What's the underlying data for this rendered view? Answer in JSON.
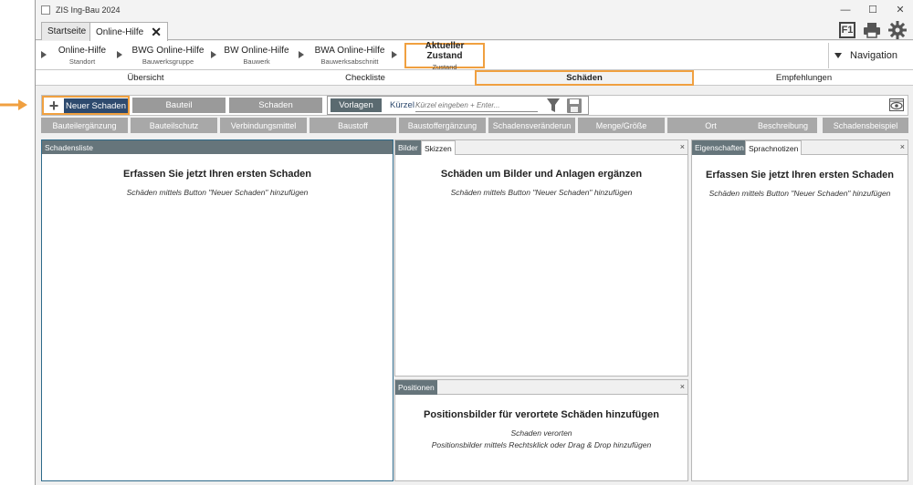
{
  "window": {
    "title": "ZIS Ing-Bau 2024",
    "minimize": "—",
    "maximize": "☐",
    "close": "✕"
  },
  "tabs": [
    {
      "label": "Startseite"
    },
    {
      "label": "Online-Hilfe"
    }
  ],
  "tab_close": "✕",
  "top_right": {
    "help_label": "F1"
  },
  "breadcrumb": [
    {
      "main": "Online-Hilfe",
      "sub": "Standort"
    },
    {
      "main": "BWG Online-Hilfe",
      "sub": "Bauwerksgruppe"
    },
    {
      "main": "BW Online-Hilfe",
      "sub": "Bauwerk"
    },
    {
      "main": "BWA Online-Hilfe",
      "sub": "Bauwerksabschnitt"
    },
    {
      "main": "Aktueller Zustand",
      "sub": "Zustand"
    }
  ],
  "navigation_label": "Navigation",
  "section_tabs": [
    {
      "label": "Übersicht"
    },
    {
      "label": "Checkliste"
    },
    {
      "label": "Schäden"
    },
    {
      "label": "Empfehlungen"
    }
  ],
  "toolbar": {
    "new_damage": "Neuer Schaden",
    "bauteil": "Bauteil",
    "schaden": "Schaden",
    "vorlagen": "Vorlagen",
    "kuerzel_label": "Kürzel",
    "kuerzel_placeholder": "Kürzel eingeben + Enter..."
  },
  "filters": [
    "Bauteilergänzung",
    "Bauteilschutz",
    "Verbindungsmittel",
    "Baustoff",
    "Baustoffergänzung",
    "Schadensveränderun",
    "Menge/Größe",
    "Ort",
    "Beschreibung",
    "Schadensbeispiel"
  ],
  "panels": {
    "schadensliste": {
      "title": "Schadensliste",
      "heading": "Erfassen Sie jetzt Ihren ersten Schaden",
      "note": "Schäden mittels Button \"Neuer Schaden\" hinzufügen"
    },
    "bilder": {
      "tab1": "Bilder",
      "tab2": "Skizzen",
      "heading": "Schäden um Bilder und Anlagen ergänzen",
      "note": "Schäden mittels Button \"Neuer Schaden\" hinzufügen"
    },
    "positionen": {
      "title": "Positionen",
      "heading": "Positionsbilder für verortete Schäden hinzufügen",
      "note1": "Schaden verorten",
      "note2": "Positionsbilder mittels Rechtsklick oder Drag & Drop hinzufügen"
    },
    "eigenschaften": {
      "tab1": "Eigenschaften",
      "tab2": "Sprachnotizen",
      "heading": "Erfassen Sie jetzt Ihren ersten Schaden",
      "note": "Schäden mittels Button \"Neuer Schaden\" hinzufügen"
    },
    "close": "×"
  },
  "colors": {
    "accent": "#f0a040",
    "header": "#66757b",
    "primary_btn": "#2e4a6e"
  }
}
